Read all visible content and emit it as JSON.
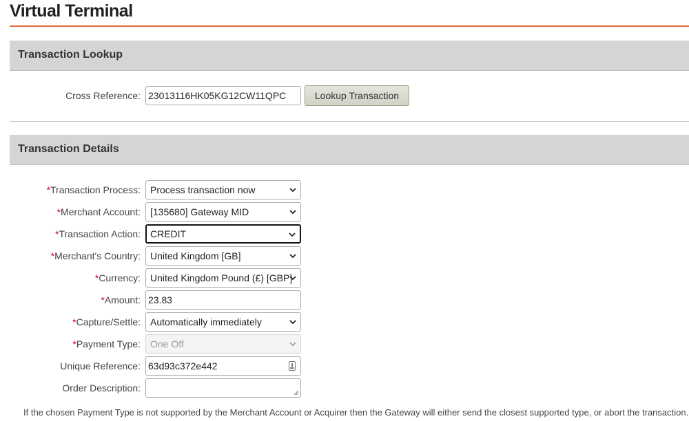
{
  "page": {
    "title": "Virtual Terminal",
    "accent_color": "#e4693a"
  },
  "lookup": {
    "section_title": "Transaction Lookup",
    "cross_reference_label": "Cross Reference:",
    "cross_reference_value": "23013116HK05KG12CW11QPC",
    "button_label": "Lookup Transaction"
  },
  "details": {
    "section_title": "Transaction Details",
    "required_marker": "*",
    "fields": {
      "transaction_process": {
        "label": "Transaction Process:",
        "value": "Process transaction now"
      },
      "merchant_account": {
        "label": "Merchant Account:",
        "value": "[135680] Gateway MID"
      },
      "transaction_action": {
        "label": "Transaction Action:",
        "value": "CREDIT"
      },
      "merchant_country": {
        "label": "Merchant's Country:",
        "value": "United Kingdom [GB]"
      },
      "currency": {
        "label": "Currency:",
        "value": "United Kingdom Pound (£) [GBP]"
      },
      "amount": {
        "label": "Amount:",
        "value": "23.83"
      },
      "capture_settle": {
        "label": "Capture/Settle:",
        "value": "Automatically immediately"
      },
      "payment_type": {
        "label": "Payment Type:",
        "value": "One Off"
      },
      "unique_reference": {
        "label": "Unique Reference:",
        "value": "63d93c372e442"
      },
      "order_description": {
        "label": "Order Description:",
        "value": ""
      }
    },
    "footnote": "If the chosen Payment Type is not supported by the Merchant Account or Acquirer then the Gateway will either send the closest supported type, or abort the transaction."
  }
}
